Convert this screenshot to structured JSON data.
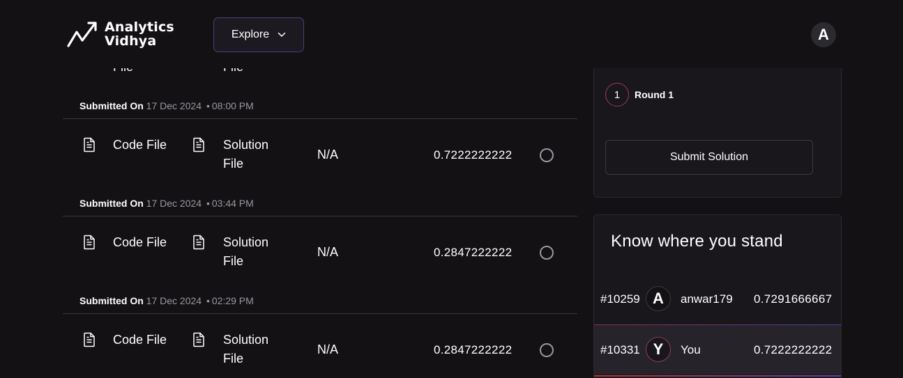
{
  "header": {
    "logo_line1": "Analytics",
    "logo_line2": "Vidhya",
    "explore_label": "Explore",
    "user_initial": "A"
  },
  "partial_row": {
    "code_frag": "File",
    "solution_frag": "File"
  },
  "submitted_prefix": "Submitted On",
  "submissions": [
    {
      "date": "17 Dec 2024",
      "time": "08:00 PM",
      "code_label": "Code File",
      "solution_label": "Solution File",
      "private_score": "N/A",
      "public_score": "0.7222222222"
    },
    {
      "date": "17 Dec 2024",
      "time": "03:44 PM",
      "code_label": "Code File",
      "solution_label": "Solution File",
      "private_score": "N/A",
      "public_score": "0.2847222222"
    },
    {
      "date": "17 Dec 2024",
      "time": "02:29 PM",
      "code_label": "Code File",
      "solution_label": "Solution File",
      "private_score": "N/A",
      "public_score": "0.2847222222"
    }
  ],
  "round": {
    "number": "1",
    "label": "Round 1",
    "submit_label": "Submit Solution"
  },
  "leaderboard": {
    "title": "Know where you stand",
    "rows": [
      {
        "rank": "#10259",
        "initial": "A",
        "name": "anwar179",
        "score": "0.7291666667"
      },
      {
        "rank": "#10331",
        "initial": "Y",
        "name": "You",
        "score": "0.7222222222"
      }
    ]
  },
  "colors": {
    "background": "#131114",
    "card": "#19171b",
    "muted_text": "#9a98a0",
    "accent_border": "#4b3f78",
    "accent_red": "#9b3a5a"
  }
}
